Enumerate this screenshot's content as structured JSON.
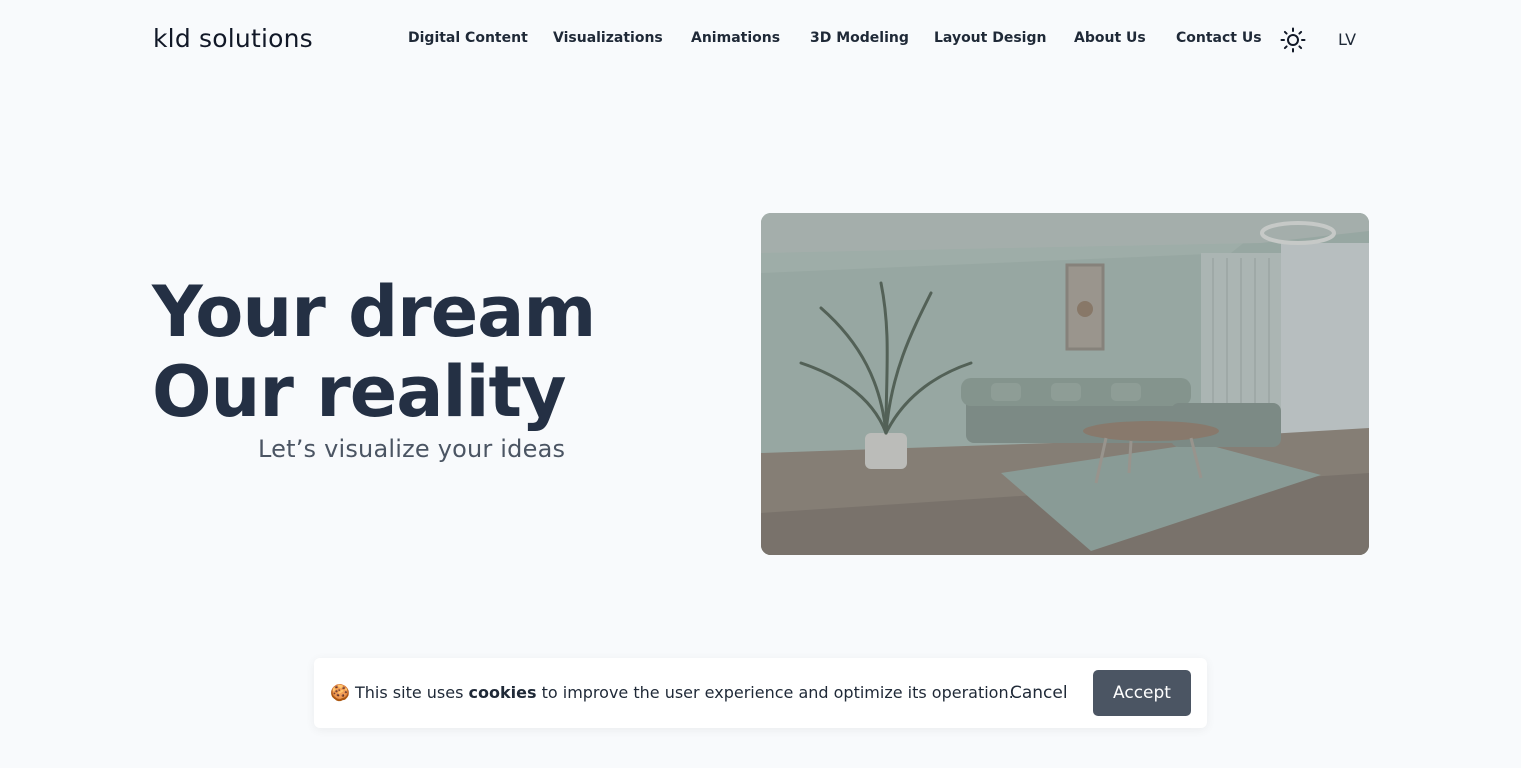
{
  "header": {
    "logo": "kld solutions",
    "nav": [
      {
        "label": "Digital Content"
      },
      {
        "label": "Visualizations"
      },
      {
        "label": "Animations"
      },
      {
        "label": "3D Modeling"
      },
      {
        "label": "Layout Design"
      },
      {
        "label": "About Us"
      },
      {
        "label": "Contact Us"
      }
    ],
    "theme_icon": "sun-icon",
    "language": "LV"
  },
  "hero": {
    "title_line1": "Your dream",
    "title_line2": "Our reality",
    "subtitle": "Let’s visualize your ideas",
    "image_subject": "living room interior render"
  },
  "cookie_bar": {
    "emoji": "🍪",
    "text_before": "This site uses",
    "text_bold": "cookies",
    "text_after": "to improve the user experience and optimize its operation.",
    "cancel_label": "Cancel",
    "accept_label": "Accept"
  },
  "colors": {
    "background": "#f8fafc",
    "heading": "#243044",
    "accept_button": "#4b5563"
  }
}
